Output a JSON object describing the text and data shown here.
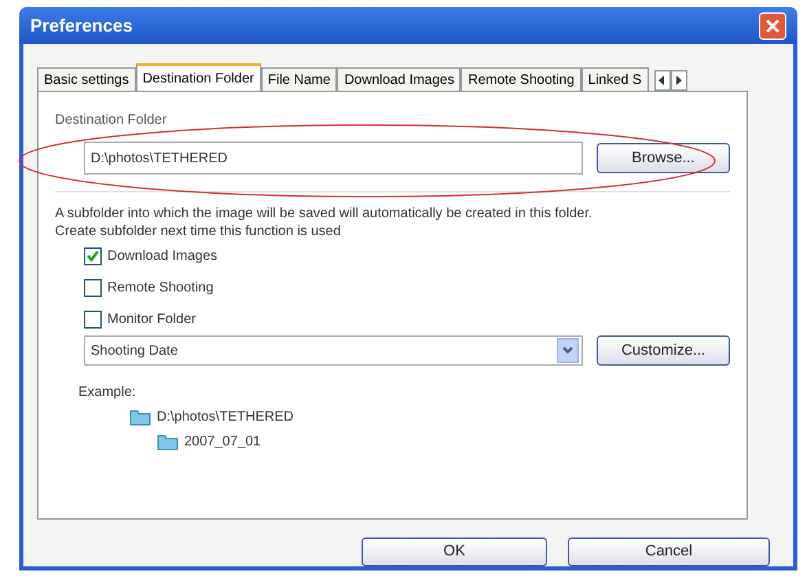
{
  "window": {
    "title": "Preferences"
  },
  "tabs": [
    {
      "label": "Basic settings",
      "selected": false
    },
    {
      "label": "Destination Folder",
      "selected": true
    },
    {
      "label": "File Name",
      "selected": false
    },
    {
      "label": "Download Images",
      "selected": false
    },
    {
      "label": "Remote Shooting",
      "selected": false
    },
    {
      "label": "Linked S",
      "selected": false
    }
  ],
  "destination": {
    "label": "Destination Folder",
    "value": "D:\\photos\\TETHERED",
    "browse": "Browse..."
  },
  "description": [
    "A subfolder into which the image will be saved will automatically be created in this folder.",
    "Create subfolder next time this function is used"
  ],
  "options": [
    {
      "label": "Download Images",
      "checked": true
    },
    {
      "label": "Remote Shooting",
      "checked": false
    },
    {
      "label": "Monitor Folder",
      "checked": false
    }
  ],
  "subfolder": {
    "value": "Shooting Date",
    "customize": "Customize..."
  },
  "example": {
    "label": "Example:",
    "tree": [
      {
        "name": "D:\\photos\\TETHERED",
        "children": [
          {
            "name": "2007_07_01"
          }
        ]
      }
    ]
  },
  "buttons": [
    "OK",
    "Cancel"
  ]
}
